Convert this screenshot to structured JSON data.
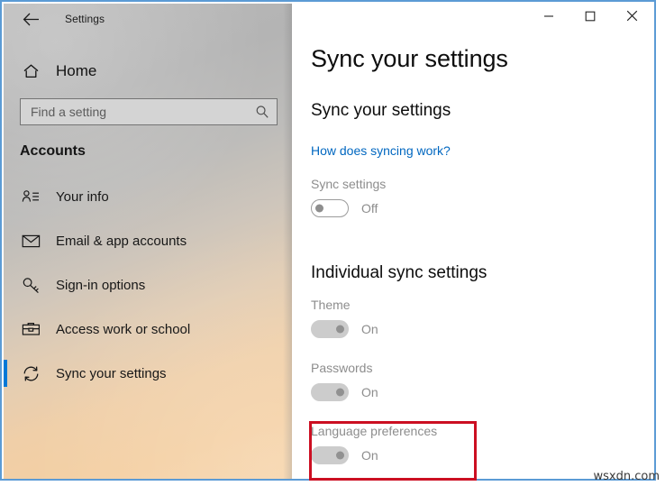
{
  "window": {
    "app_title": "Settings",
    "back_icon": "back-arrow-icon",
    "controls": {
      "minimize": "minimize-icon",
      "maximize": "maximize-icon",
      "close": "close-icon"
    }
  },
  "sidebar": {
    "home_label": "Home",
    "home_icon": "home-icon",
    "search": {
      "value": "",
      "placeholder": "Find a setting",
      "icon": "search-icon"
    },
    "section_title": "Accounts",
    "items": [
      {
        "label": "Your info",
        "icon": "user-info-icon",
        "selected": false
      },
      {
        "label": "Email & app accounts",
        "icon": "envelope-icon",
        "selected": false
      },
      {
        "label": "Sign-in options",
        "icon": "key-icon",
        "selected": false
      },
      {
        "label": "Access work or school",
        "icon": "briefcase-icon",
        "selected": false
      },
      {
        "label": "Sync your settings",
        "icon": "sync-arrows-icon",
        "selected": true
      }
    ]
  },
  "main": {
    "page_title": "Sync your settings",
    "section1_title": "Sync your settings",
    "help_link": "How does syncing work?",
    "sync_setting": {
      "label": "Sync settings",
      "state": "Off",
      "enabled": true,
      "on": false
    },
    "section2_title": "Individual sync settings",
    "individual": [
      {
        "label": "Theme",
        "state": "On",
        "on": true,
        "enabled": false
      },
      {
        "label": "Passwords",
        "state": "On",
        "on": true,
        "enabled": false
      },
      {
        "label": "Language preferences",
        "state": "On",
        "on": true,
        "enabled": false
      }
    ]
  },
  "annotation": {
    "target": "Language preferences",
    "color": "#cc0f22"
  },
  "watermark": "wsxdn.com"
}
